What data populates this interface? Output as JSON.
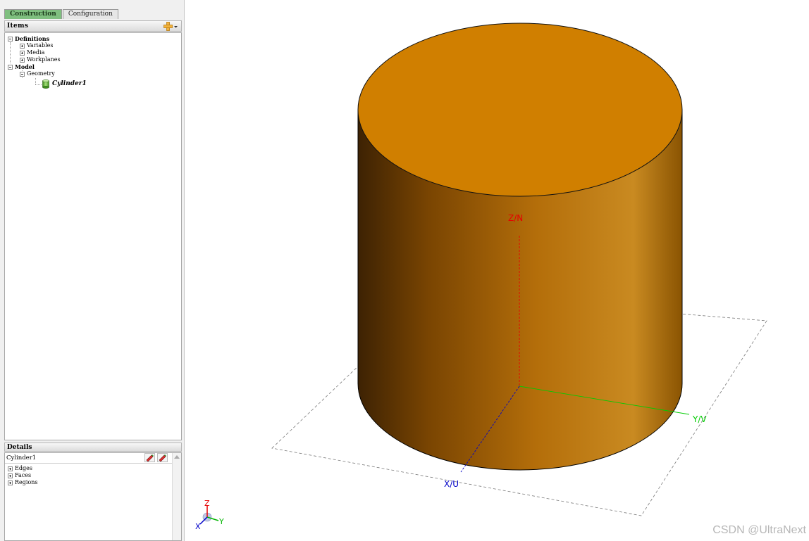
{
  "tabs": {
    "construction": "Construction",
    "configuration": "Configuration"
  },
  "items_panel": {
    "title": "Items",
    "tree": {
      "definitions": "Definitions",
      "variables": "Variables",
      "media": "Media",
      "workplanes": "Workplanes",
      "model": "Model",
      "geometry": "Geometry",
      "cylinder": "Cylinder1"
    }
  },
  "details_panel": {
    "title": "Details",
    "name": "Cylinder1",
    "nodes": {
      "edges": "Edges",
      "faces": "Faces",
      "regions": "Regions"
    }
  },
  "viewport": {
    "axis_labels": {
      "z": "Z/N",
      "y": "Y/V",
      "x": "X/U"
    },
    "triad_labels": {
      "z": "Z",
      "y": "Y",
      "x": "X"
    },
    "colors": {
      "cylinder_top": "#d07f00",
      "cylinder_side_light": "#c98a21",
      "cylinder_side_dark": "#3d2203",
      "axis_z": "#e60000",
      "axis_y": "#00cc00",
      "axis_x": "#0000c8"
    }
  },
  "watermark": "CSDN @UltraNext"
}
